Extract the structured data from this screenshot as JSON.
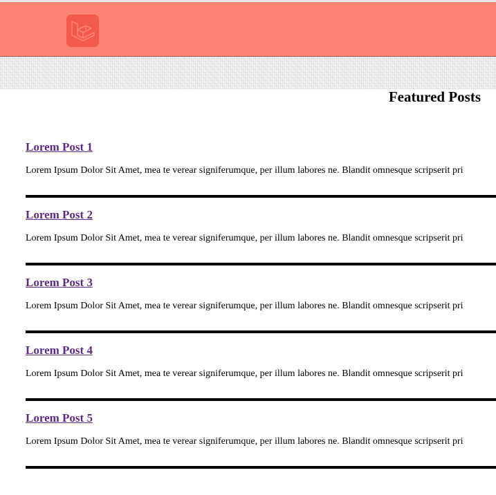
{
  "header": {
    "logo_icon": "laravel-logo-icon",
    "background_color": "#fd8373",
    "logo_color": "#f45a4c"
  },
  "main": {
    "section_title": "Featured Posts",
    "posts": [
      {
        "title": "Lorem Post 1",
        "excerpt": "Lorem Ipsum Dolor Sit Amet, mea te verear signiferumque, per illum labores ne. Blandit omnesque scripserit pri"
      },
      {
        "title": "Lorem Post 2",
        "excerpt": "Lorem Ipsum Dolor Sit Amet, mea te verear signiferumque, per illum labores ne. Blandit omnesque scripserit pri"
      },
      {
        "title": "Lorem Post 3",
        "excerpt": "Lorem Ipsum Dolor Sit Amet, mea te verear signiferumque, per illum labores ne. Blandit omnesque scripserit pri"
      },
      {
        "title": "Lorem Post 4",
        "excerpt": "Lorem Ipsum Dolor Sit Amet, mea te verear signiferumque, per illum labores ne. Blandit omnesque scripserit pri"
      },
      {
        "title": "Lorem Post 5",
        "excerpt": "Lorem Ipsum Dolor Sit Amet, mea te verear signiferumque, per illum labores ne. Blandit omnesque scripserit pri"
      }
    ],
    "link_color": "#5b2a86"
  }
}
